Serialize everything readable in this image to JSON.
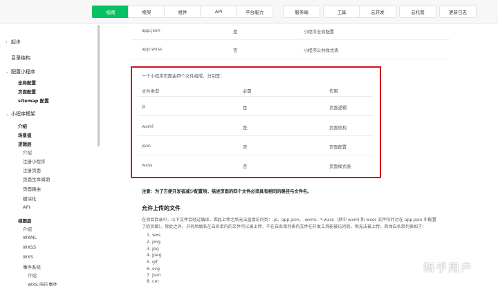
{
  "nav": {
    "items": [
      "指南",
      "框架",
      "组件",
      "API",
      "平台能力",
      "服务端",
      "工具",
      "云开发",
      "云托管",
      "更新日志"
    ],
    "active": 0
  },
  "sidebar": {
    "items": [
      {
        "label": "起步",
        "level": "h1",
        "arrow": "›"
      },
      {
        "label": "目录结构",
        "level": "h1",
        "arrow": ""
      },
      {
        "label": "配置小程序",
        "level": "h1",
        "arrow": "⌄"
      },
      {
        "label": "全局配置",
        "level": "h2"
      },
      {
        "label": "页面配置",
        "level": "h2"
      },
      {
        "label": "sitemap 配置",
        "level": "h2"
      },
      {
        "label": "小程序框架",
        "level": "h1",
        "arrow": "⌄"
      },
      {
        "label": "介绍",
        "level": "h2"
      },
      {
        "label": "场景值",
        "level": "h2"
      },
      {
        "label": "逻辑层",
        "level": "h2"
      },
      {
        "label": "介绍",
        "level": "h3"
      },
      {
        "label": "注册小程序",
        "level": "h3"
      },
      {
        "label": "注册页面",
        "level": "h3"
      },
      {
        "label": "页面生命周期",
        "level": "h3"
      },
      {
        "label": "页面路由",
        "level": "h3"
      },
      {
        "label": "模块化",
        "level": "h3"
      },
      {
        "label": "API",
        "level": "h3"
      },
      {
        "label": "视图层",
        "level": "h2"
      },
      {
        "label": "介绍",
        "level": "h3"
      },
      {
        "label": "WXML",
        "level": "h3"
      },
      {
        "label": "WXSS",
        "level": "h3"
      },
      {
        "label": "WXS",
        "level": "h3"
      },
      {
        "label": "事件系统",
        "level": "h3"
      },
      {
        "label": "介绍",
        "level": "h4"
      },
      {
        "label": "WXS 响应事件",
        "level": "h4"
      }
    ]
  },
  "top_table": {
    "rows": [
      [
        "app.json",
        "是",
        "小程序全局配置"
      ],
      [
        "app.wxss",
        "否",
        "小程序公共样式表"
      ]
    ]
  },
  "page_table": {
    "intro": "一个小程序页面由四个文件组成，分别是：",
    "headers": [
      "文件类型",
      "必需",
      "作用"
    ],
    "rows": [
      [
        "js",
        "是",
        "页面逻辑"
      ],
      [
        "wxml",
        "是",
        "页面结构"
      ],
      [
        "json",
        "否",
        "页面配置"
      ],
      [
        "wxss",
        "否",
        "页面样式表"
      ]
    ]
  },
  "note": "注意：为了方便开发者减少配置项，描述页面的四个文件必须具有相同的路径与文件名。",
  "section": {
    "title": "允许上传的文件",
    "para1": "在项目目录中，以下文件会经过编译，因此上传之后无法直接访问到：.js、app.json、.wxml、*.wxss（其中 wxml 和 wxss 文件仅针对在 app.json 中配置",
    "para2": "了的页面）。除此之外，只有后缀名在白名单内的文件可以被上传，不在白名单列表内文件在开发工具能被访问到，但无法被上传。具体白名单列表如下：",
    "list": [
      "1. wxs",
      "2. png",
      "3. jpg",
      "4. jpeg",
      "5. gif",
      "6. svg",
      "7. json",
      "8. cer"
    ]
  },
  "watermark": "知乎用户"
}
